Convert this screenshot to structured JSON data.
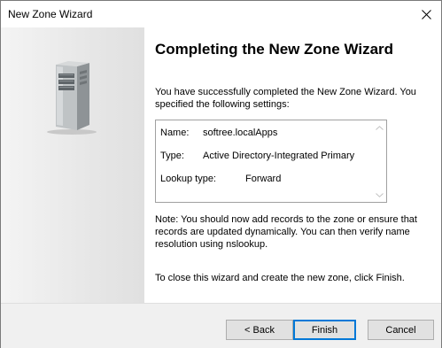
{
  "window": {
    "title": "New Zone Wizard"
  },
  "page": {
    "heading": "Completing the New Zone Wizard",
    "intro": "You have successfully completed the New Zone Wizard. You specified the following settings:",
    "settings": {
      "name_label": "Name:",
      "name_value": "softree.localApps",
      "type_label": "Type:",
      "type_value": "Active Directory-Integrated Primary",
      "lookup_label": "Lookup type:",
      "lookup_value": "Forward"
    },
    "note": "Note: You should now add records to the zone or ensure that records are updated dynamically. You can then verify name resolution using nslookup.",
    "closing": "To close this wizard and create the new zone, click Finish."
  },
  "buttons": {
    "back": "< Back",
    "finish": "Finish",
    "cancel": "Cancel"
  },
  "icons": {
    "close": "close-icon",
    "server": "server-icon",
    "scroll_up": "scroll-up-arrow-icon",
    "scroll_down": "scroll-down-arrow-icon"
  }
}
